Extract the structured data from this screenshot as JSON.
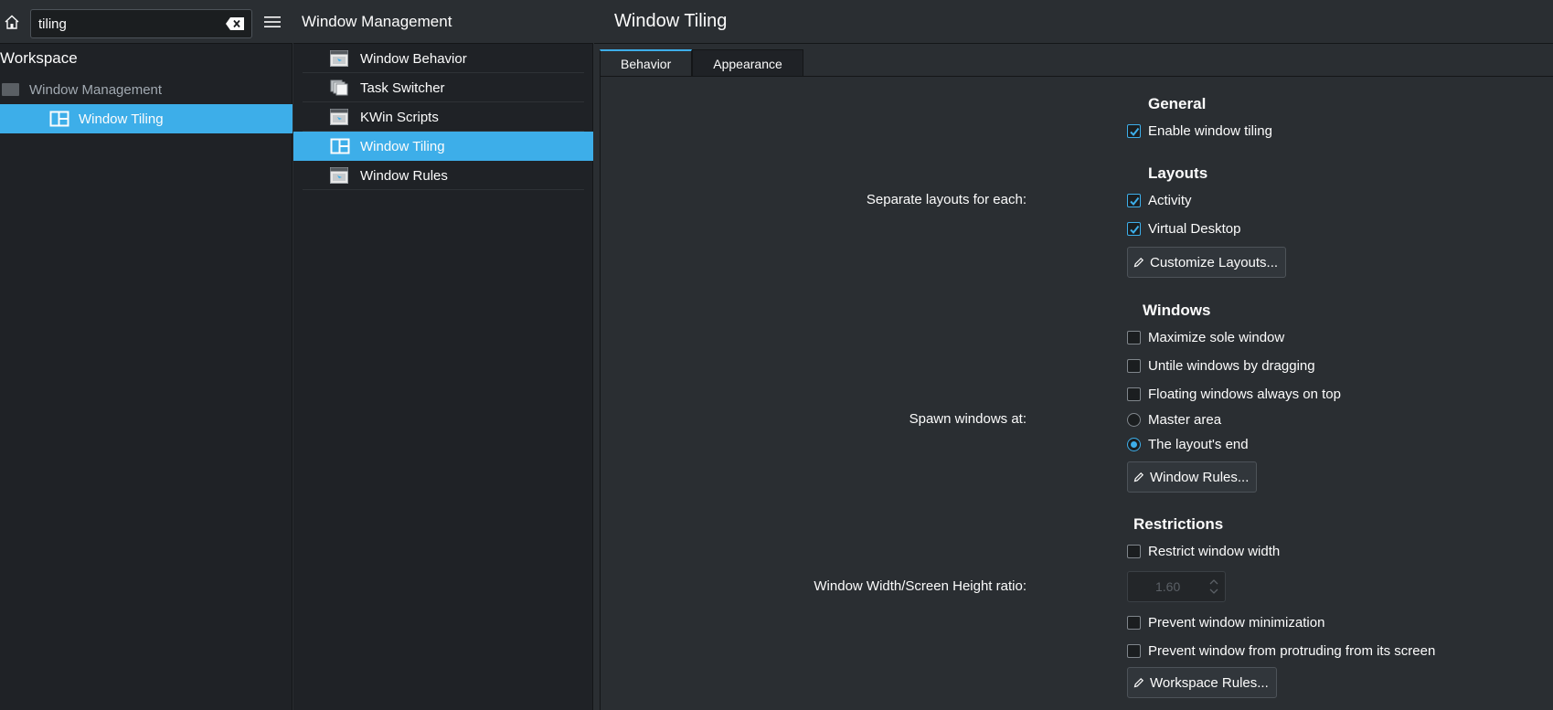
{
  "sidebar": {
    "search_value": "tiling",
    "section_title": "Workspace",
    "category": "Window Management",
    "selected_item": "Window Tiling"
  },
  "module_list": {
    "title": "Window Management",
    "items": [
      {
        "label": "Window Behavior"
      },
      {
        "label": "Task Switcher"
      },
      {
        "label": "KWin Scripts"
      },
      {
        "label": "Window Tiling"
      },
      {
        "label": "Window Rules"
      }
    ],
    "selected_index": 3
  },
  "page": {
    "title": "Window Tiling",
    "tabs": [
      {
        "label": "Behavior"
      },
      {
        "label": "Appearance"
      }
    ],
    "active_tab": 0
  },
  "form": {
    "general": {
      "heading": "General",
      "enable_tiling": {
        "label": "Enable window tiling",
        "checked": true
      }
    },
    "layouts": {
      "heading": "Layouts",
      "separate_label": "Separate layouts for each:",
      "activity": {
        "label": "Activity",
        "checked": true
      },
      "virtual_desktop": {
        "label": "Virtual Desktop",
        "checked": true
      },
      "customize_button": "Customize Layouts..."
    },
    "windows": {
      "heading": "Windows",
      "maximize_sole": {
        "label": "Maximize sole window",
        "checked": false
      },
      "untile_dragging": {
        "label": "Untile windows by dragging",
        "checked": false
      },
      "floating_on_top": {
        "label": "Floating windows always on top",
        "checked": false
      },
      "spawn_label": "Spawn windows at:",
      "spawn_master": {
        "label": "Master area",
        "selected": false
      },
      "spawn_end": {
        "label": "The layout's end",
        "selected": true
      },
      "rules_button": "Window Rules..."
    },
    "restrictions": {
      "heading": "Restrictions",
      "restrict_width": {
        "label": "Restrict window width",
        "checked": false
      },
      "ratio_label": "Window Width/Screen Height ratio:",
      "ratio_value": "1.60",
      "prevent_minimization": {
        "label": "Prevent window minimization",
        "checked": false
      },
      "prevent_protruding": {
        "label": "Prevent window from protruding from its screen",
        "checked": false
      },
      "workspace_button": "Workspace Rules..."
    }
  },
  "colors": {
    "accent": "#3daee9",
    "background": "#2a2e32",
    "sidebar": "#1f2226",
    "text": "#fcfcfc"
  }
}
